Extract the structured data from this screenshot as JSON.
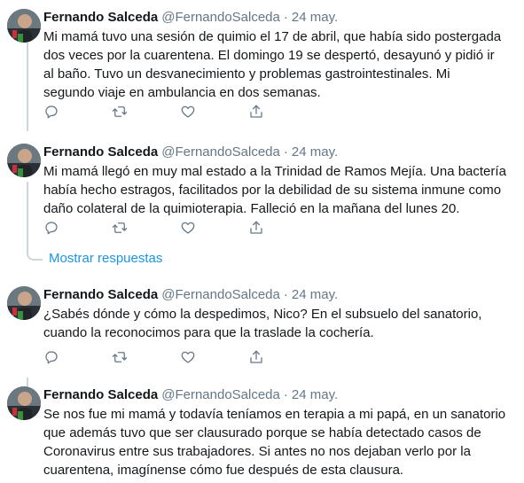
{
  "colors": {
    "text": "#14171a",
    "secondary": "#657786",
    "link": "#1b95e0",
    "thread_line": "#ccd6dd"
  },
  "icons": [
    "reply-icon",
    "retweet-icon",
    "like-icon",
    "share-icon"
  ],
  "tweets": [
    {
      "author_name": "Fernando Salceda",
      "author_handle": "@FernandoSalceda",
      "separator": "·",
      "date": "24 may.",
      "text": "Mi mamá tuvo una sesión de quimio el 17 de abril, que había sido postergada\ndos veces por la cuarentena. El domingo 19 se despertó, desayunó y pidió ir\nal baño. Tuvo un desvanecimiento y problemas gastrointestinales. Mi\nsegundo viaje en ambulancia en dos semanas."
    },
    {
      "author_name": "Fernando Salceda",
      "author_handle": "@FernandoSalceda",
      "separator": "·",
      "date": "24 may.",
      "text": "Mi mamá llegó en muy mal estado a la Trinidad de Ramos Mejía. Una bactería\nhabía hecho estragos, facilitados por la debilidad de su sistema inmune como\ndaño colateral de la quimioterapia. Falleció en la mañana del lunes 20."
    },
    {
      "author_name": "Fernando Salceda",
      "author_handle": "@FernandoSalceda",
      "separator": "·",
      "date": "24 may.",
      "text": "¿Sabés dónde y cómo la despedimos, Nico? En el subsuelo del sanatorio,\ncuando la reconocimos para que la traslade la cochería."
    },
    {
      "author_name": "Fernando Salceda",
      "author_handle": "@FernandoSalceda",
      "separator": "·",
      "date": "24 may.",
      "text": "Se nos fue mi mamá y todavía teníamos en terapia a mi papá, en un sanatorio\nque además tuvo que ser clausurado porque se había detectado casos de\nCoronavirus entre sus trabajadores. Si antes no nos dejaban verlo por la\ncuarentena, imagínense cómo fue después de esta clausura."
    }
  ],
  "show_replies_label": "Mostrar respuestas"
}
